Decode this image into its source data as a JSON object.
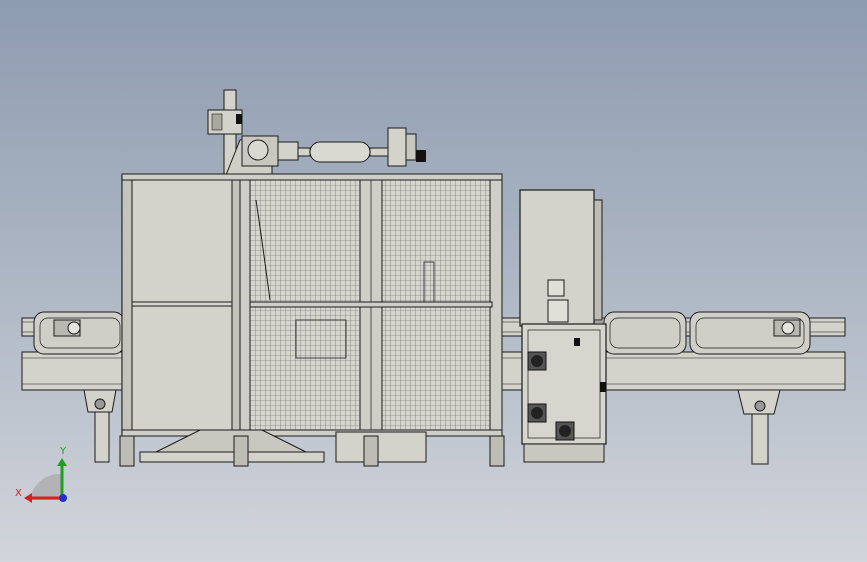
{
  "viewport": {
    "background_top": "#8e9cb0",
    "background_bottom": "#d2d5db"
  },
  "model": {
    "colors": {
      "body": "#d3d3cb",
      "body_dark": "#a9a9a1",
      "line": "#1a1a1a",
      "mesh": "#5a5a5a",
      "black": "#111111"
    }
  },
  "triad": {
    "x_label": "X",
    "y_label": "Y",
    "x_color": "#d82020",
    "y_color": "#20a020",
    "z_color": "#2030d0"
  }
}
